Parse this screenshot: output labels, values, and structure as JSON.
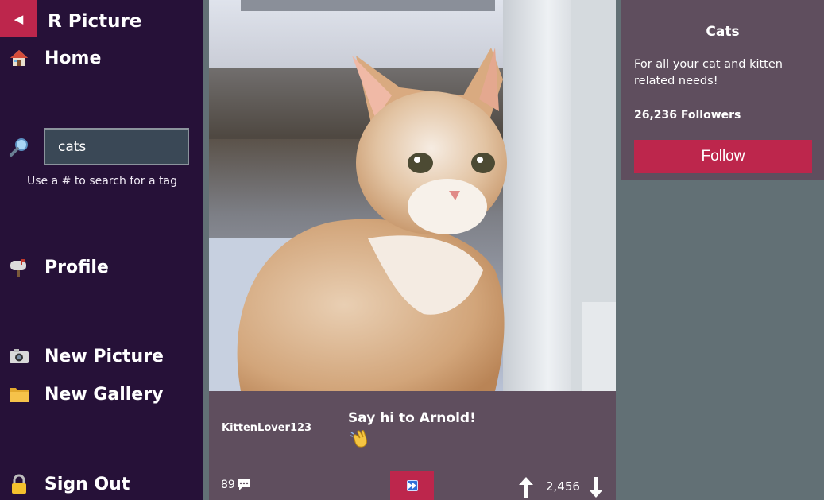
{
  "app": {
    "title": "R Picture",
    "back_icon": "back-arrow-icon"
  },
  "sidebar": {
    "home": {
      "label": "Home",
      "icon": "house-icon"
    },
    "search": {
      "value": "cats",
      "hint": "Use a # to search for a tag",
      "icon": "magnifier-icon"
    },
    "profile": {
      "label": "Profile",
      "icon": "mailbox-icon"
    },
    "new_picture": {
      "label": "New Picture",
      "icon": "camera-icon"
    },
    "new_gallery": {
      "label": "New Gallery",
      "icon": "folder-icon"
    },
    "sign_out": {
      "label": "Sign Out",
      "icon": "lock-icon"
    }
  },
  "post": {
    "author": "KittenLover123",
    "caption": "Say hi to Arnold!",
    "caption_emoji": "waving-hand-icon",
    "comments": "89",
    "votes": "2,456"
  },
  "tag": {
    "name": "Cats",
    "description": "For all your cat and kitten related needs!",
    "followers": "26,236 Followers",
    "follow_label": "Follow"
  },
  "colors": {
    "sidebar_bg": "#261138",
    "accent": "#bd264c",
    "card_bg": "#5f4e5e",
    "page_bg": "#627075",
    "search_bg": "#3a4856"
  }
}
